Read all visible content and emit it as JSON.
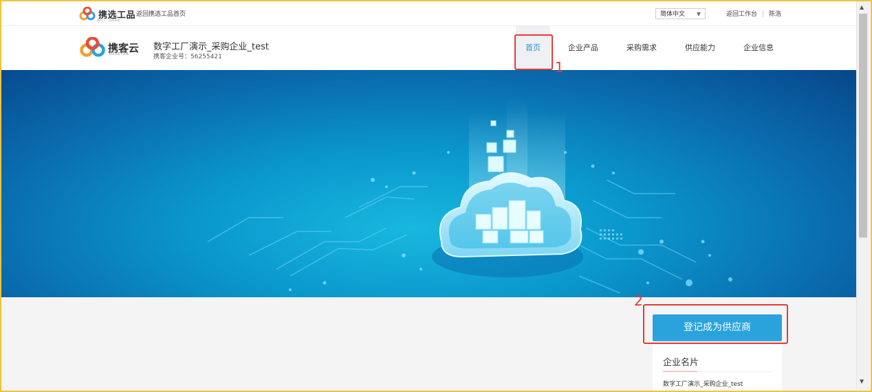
{
  "topbar": {
    "brand": "携选工品",
    "brand_tag": "携手万一·智选未来",
    "back_home": "返回携选工品首页",
    "language": "简体中文",
    "workbench": "返回工作台",
    "user": "陈浩"
  },
  "header": {
    "logo_name": "携客云",
    "logo_sub": "XIEKEYUN",
    "company_name": "数字工厂演示_采购企业_test",
    "company_id": "携客企业号：56255421"
  },
  "nav": {
    "items": [
      "首页",
      "企业产品",
      "采购需求",
      "供应能力",
      "企业信息"
    ],
    "active": "首页"
  },
  "actions": {
    "register": "登记成为供应商"
  },
  "card": {
    "title": "企业名片",
    "company": "数字工厂演示_采购企业_test"
  },
  "annotations": {
    "one": "1",
    "two": "2"
  },
  "colors": {
    "accent": "#2aa3dd",
    "annotation": "#e53935",
    "frame": "#f2c33a"
  }
}
